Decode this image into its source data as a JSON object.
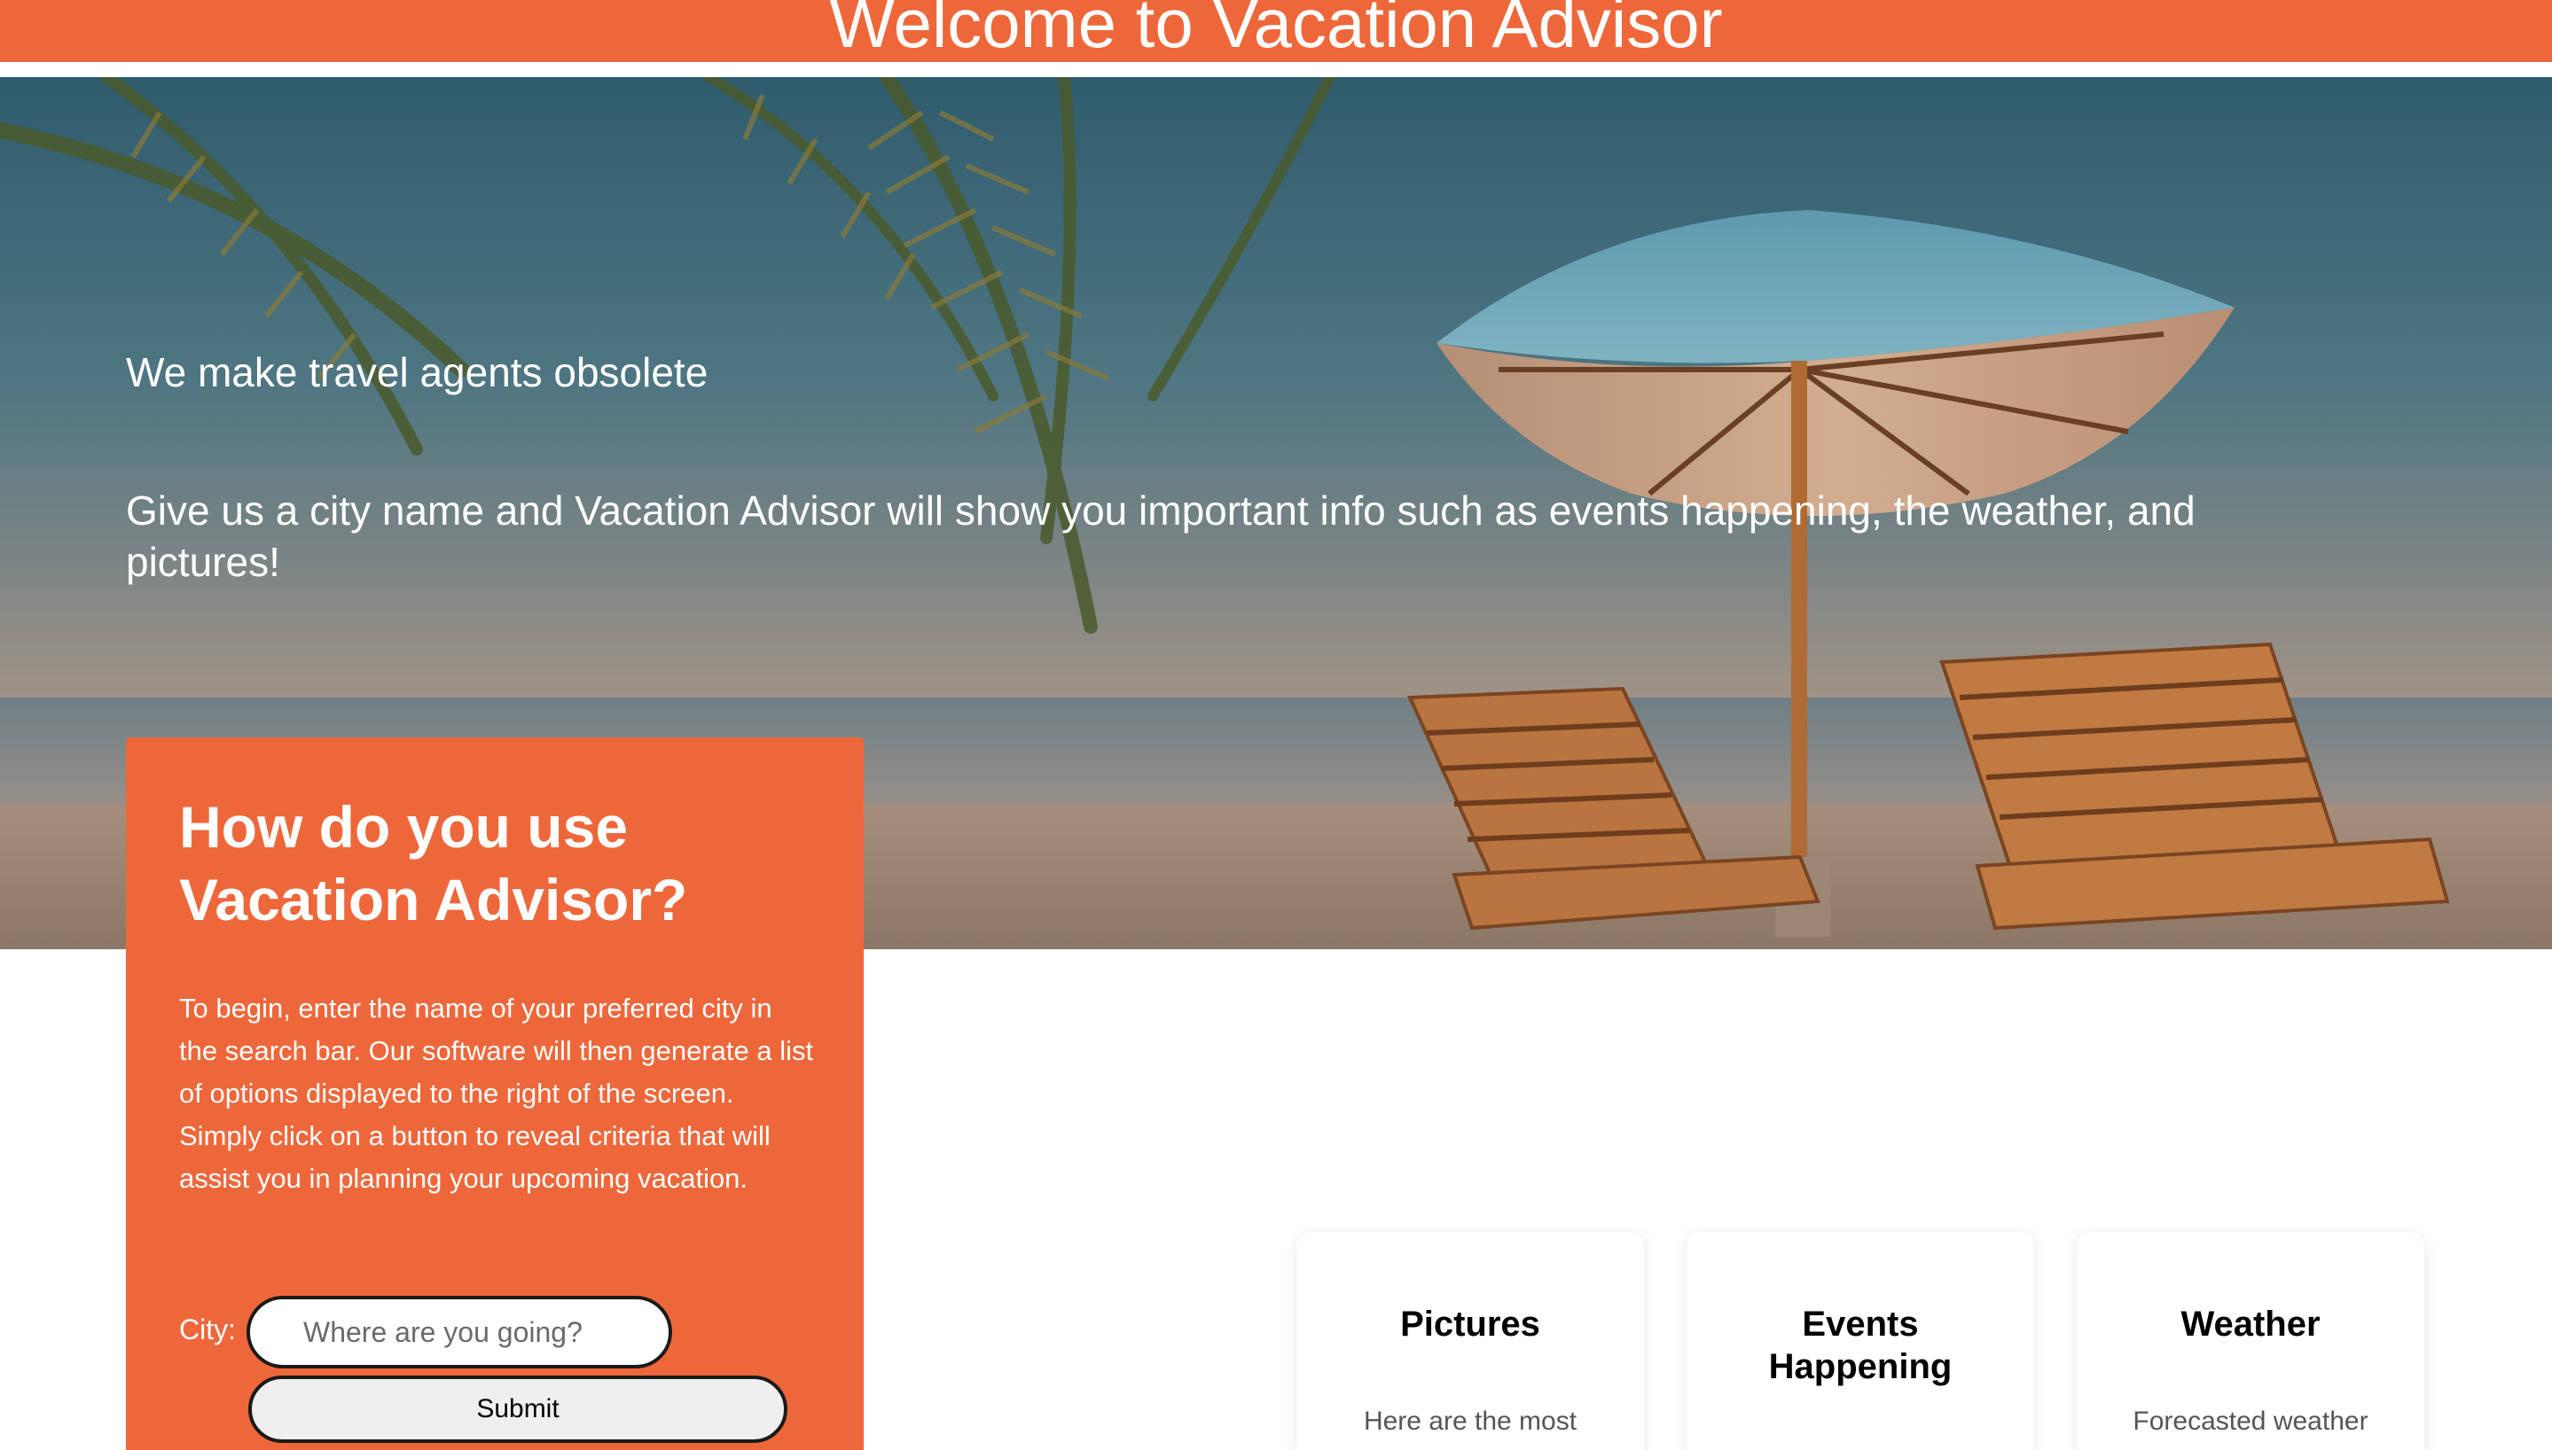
{
  "header": {
    "title": "Welcome to Vacation Advisor"
  },
  "hero": {
    "tagline": "We make travel agents obsolete",
    "description": "Give us a city name and Vacation Advisor will show you important info such as events happening, the weather, and pictures!",
    "background": "beach-with-palm-trees-umbrella-and-lounge-chairs"
  },
  "howto": {
    "title": "How do you use Vacation Advisor?",
    "body": "To begin, enter the name of your preferred city in the search bar. Our software will then generate a list of options displayed to the right of the screen. Simply click on a button to reveal criteria that will assist you in planning your upcoming vacation.",
    "city_label": "City:",
    "city_placeholder": "Where are you going?",
    "city_value": "",
    "submit_label": "Submit"
  },
  "options": [
    {
      "title": "Pictures",
      "description": "Here are the most"
    },
    {
      "title": "Events Happening",
      "description": ""
    },
    {
      "title": "Weather",
      "description": "Forecasted weather"
    }
  ],
  "colors": {
    "brand_orange": "#ee673a",
    "text_on_brand": "#ffffff",
    "card_background": "#ffffff"
  }
}
